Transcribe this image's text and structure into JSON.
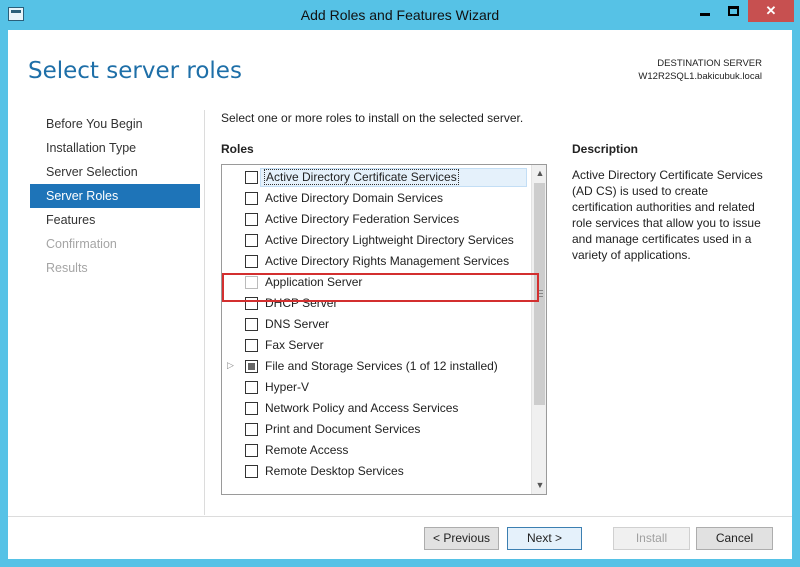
{
  "window": {
    "title": "Add Roles and Features Wizard",
    "minimize_glyph": "",
    "maximize_glyph": "",
    "close_glyph": "✕",
    "accent_color": "#56c2e6"
  },
  "header": {
    "page_title": "Select server roles",
    "destination_label": "DESTINATION SERVER",
    "destination_server": "W12R2SQL1.bakicubuk.local"
  },
  "nav": {
    "items": [
      {
        "label": "Before You Begin",
        "state": "normal"
      },
      {
        "label": "Installation Type",
        "state": "normal"
      },
      {
        "label": "Server Selection",
        "state": "normal"
      },
      {
        "label": "Server Roles",
        "state": "active"
      },
      {
        "label": "Features",
        "state": "normal"
      },
      {
        "label": "Confirmation",
        "state": "disabled"
      },
      {
        "label": "Results",
        "state": "disabled"
      }
    ],
    "active_color": "#1e74b8"
  },
  "main": {
    "instruction": "Select one or more roles to install on the selected server.",
    "roles_heading": "Roles",
    "roles": [
      {
        "label": "Active Directory Certificate Services",
        "checked": false,
        "selected": true
      },
      {
        "label": "Active Directory Domain Services",
        "checked": false
      },
      {
        "label": "Active Directory Federation Services",
        "checked": false
      },
      {
        "label": "Active Directory Lightweight Directory Services",
        "checked": false
      },
      {
        "label": "Active Directory Rights Management Services",
        "checked": false
      },
      {
        "label": "Application Server",
        "checked": false,
        "highlighted": true
      },
      {
        "label": "DHCP Server",
        "checked": false
      },
      {
        "label": "DNS Server",
        "checked": false
      },
      {
        "label": "Fax Server",
        "checked": false
      },
      {
        "label": "File and Storage Services (1 of 12 installed)",
        "checked": "partial",
        "expandable": true
      },
      {
        "label": "Hyper-V",
        "checked": false
      },
      {
        "label": "Network Policy and Access Services",
        "checked": false
      },
      {
        "label": "Print and Document Services",
        "checked": false
      },
      {
        "label": "Remote Access",
        "checked": false
      },
      {
        "label": "Remote Desktop Services",
        "checked": false
      }
    ],
    "highlight_color": "#d32f2f",
    "description_heading": "Description",
    "description_text": "Active Directory Certificate Services (AD CS) is used to create certification authorities and related role services that allow you to issue and manage certificates used in a variety of applications."
  },
  "footer": {
    "previous_label": "< Previous",
    "next_label": "Next >",
    "install_label": "Install",
    "cancel_label": "Cancel"
  }
}
